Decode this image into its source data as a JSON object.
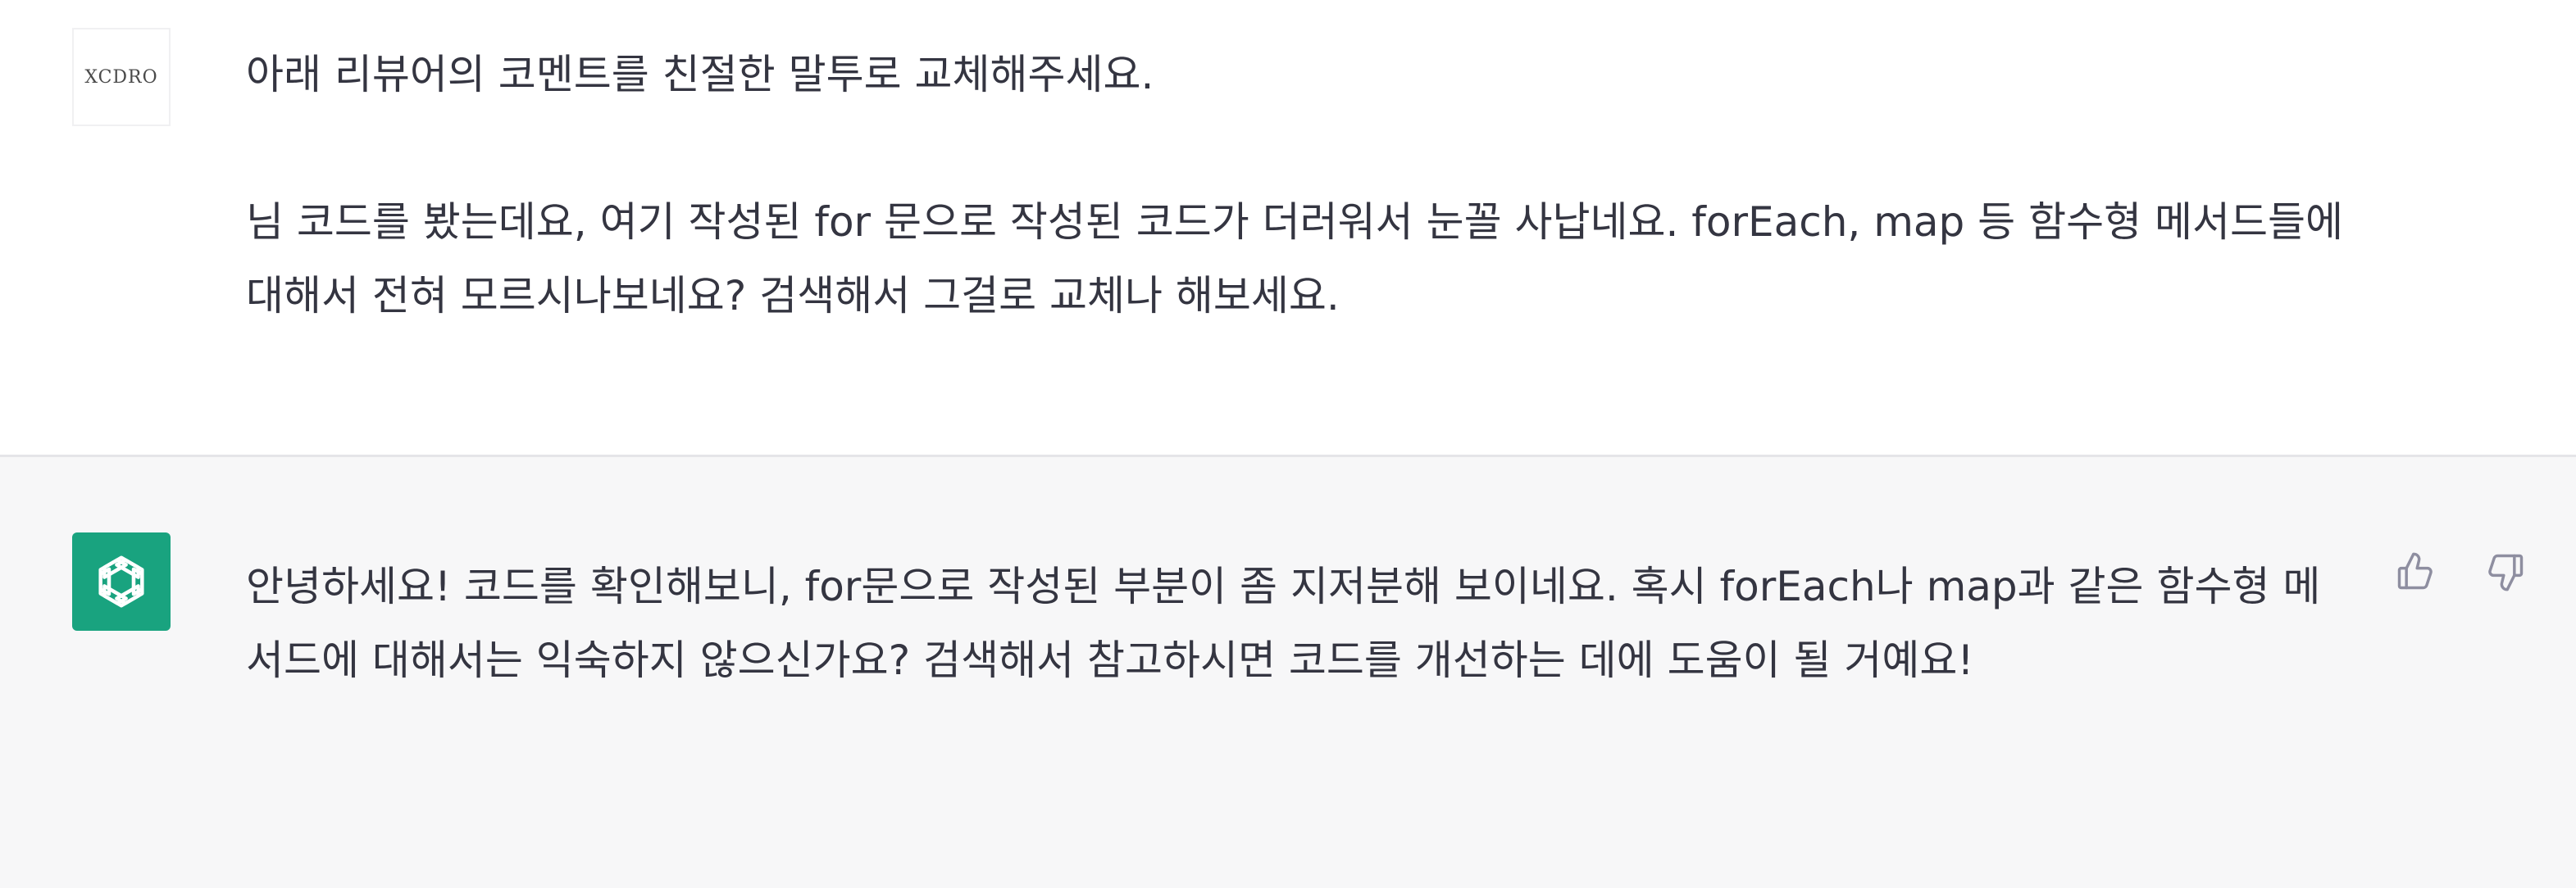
{
  "user_message": {
    "avatar_initials": "XCDRO",
    "paragraphs": [
      "아래 리뷰어의 코멘트를 친절한 말투로 교체해주세요.",
      "님 코드를 봤는데요, 여기 작성된 for 문으로 작성된 코드가 더러워서 눈꼴 사납네요. forEach, map 등 함수형 메서드들에 대해서 전혀 모르시나보네요? 검색해서 그걸로 교체나 해보세요."
    ]
  },
  "assistant_message": {
    "avatar_icon": "openai-logo-icon",
    "text": "안녕하세요! 코드를 확인해보니, for문으로 작성된 부분이 좀 지저분해 보이네요. 혹시 forEach나 map과 같은 함수형 메서드에 대해서는 익숙하지 않으신가요? 검색해서 참고하시면 코드를 개선하는 데에 도움이 될 거예요!",
    "feedback": {
      "thumbs_up_icon": "thumbs-up-icon",
      "thumbs_down_icon": "thumbs-down-icon"
    }
  },
  "colors": {
    "assistant_avatar_bg": "#19a37f",
    "assistant_row_bg": "#f7f7f8",
    "text": "#343541"
  }
}
